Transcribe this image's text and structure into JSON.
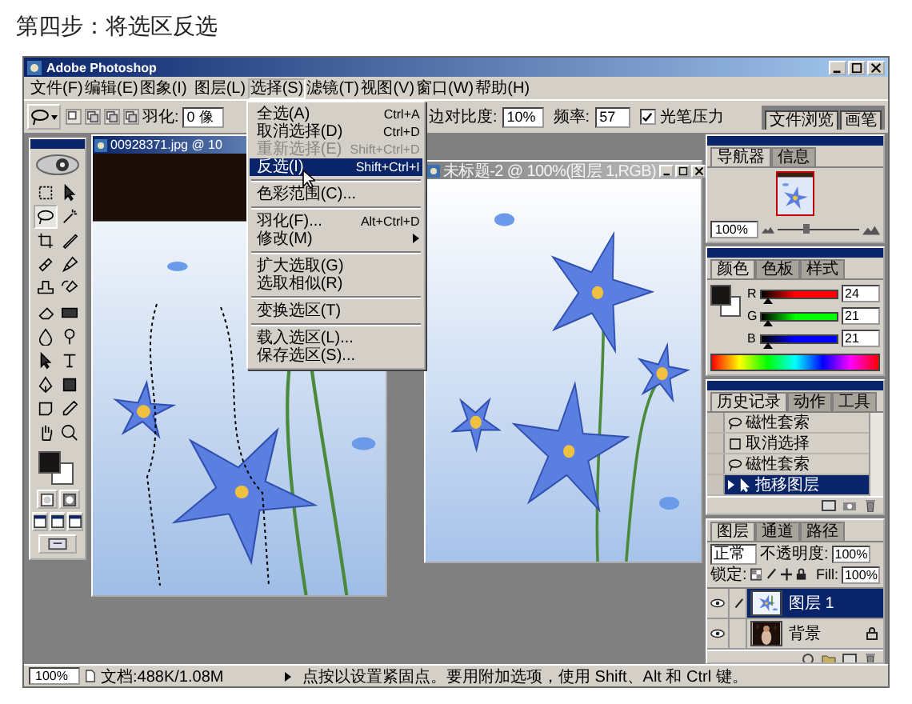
{
  "heading": "第四步：将选区反选",
  "window": {
    "title": "Adobe Photoshop"
  },
  "menu_bar": [
    {
      "label": "文件(F)",
      "selected": false
    },
    {
      "label": "编辑(E)",
      "selected": false
    },
    {
      "label": "图象(I)",
      "selected": false
    },
    {
      "label": "图层(L)",
      "selected": false
    },
    {
      "label": "选择(S)",
      "selected": true
    },
    {
      "label": "滤镜(T)",
      "selected": false
    },
    {
      "label": "视图(V)",
      "selected": false
    },
    {
      "label": "窗口(W)",
      "selected": false
    },
    {
      "label": "帮助(H)",
      "selected": false
    }
  ],
  "select_menu": [
    {
      "kind": "item",
      "label": "全选(A)",
      "shortcut": "Ctrl+A",
      "disabled": false,
      "selected": false
    },
    {
      "kind": "item",
      "label": "取消选择(D)",
      "shortcut": "Ctrl+D",
      "disabled": false,
      "selected": false
    },
    {
      "kind": "item",
      "label": "重新选择(E)",
      "shortcut": "Shift+Ctrl+D",
      "disabled": true,
      "selected": false
    },
    {
      "kind": "item",
      "label": "反选(I)",
      "shortcut": "Shift+Ctrl+I",
      "disabled": false,
      "selected": true
    },
    {
      "kind": "separator"
    },
    {
      "kind": "item",
      "label": "色彩范围(C)...",
      "disabled": false,
      "selected": false
    },
    {
      "kind": "separator"
    },
    {
      "kind": "item",
      "label": "羽化(F)...",
      "shortcut": "Alt+Ctrl+D",
      "disabled": false,
      "selected": false
    },
    {
      "kind": "submenu",
      "label": "修改(M)",
      "disabled": false,
      "selected": false
    },
    {
      "kind": "separator"
    },
    {
      "kind": "item",
      "label": "扩大选取(G)",
      "disabled": false,
      "selected": false
    },
    {
      "kind": "item",
      "label": "选取相似(R)",
      "disabled": false,
      "selected": false
    },
    {
      "kind": "separator"
    },
    {
      "kind": "item",
      "label": "变换选区(T)",
      "disabled": false,
      "selected": false
    },
    {
      "kind": "separator"
    },
    {
      "kind": "item",
      "label": "载入选区(L)...",
      "disabled": false,
      "selected": false
    },
    {
      "kind": "item",
      "label": "保存选区(S)...",
      "disabled": false,
      "selected": false
    }
  ],
  "options_bar": {
    "feather_label": "羽化:",
    "feather_value": "0 像",
    "contrast_label": "边对比度:",
    "contrast_value": "10%",
    "frequency_label": "频率:",
    "frequency_value": "57",
    "pen_pressure": {
      "label": "光笔压力",
      "checked": true
    }
  },
  "palette_well": [
    "文件浏览",
    "画笔"
  ],
  "toolbox": {
    "tools": [
      {
        "kind": "marquee",
        "selected": false
      },
      {
        "kind": "move",
        "selected": false
      },
      {
        "kind": "lasso",
        "selected": true
      },
      {
        "kind": "wand",
        "selected": false
      },
      {
        "kind": "crop",
        "selected": false
      },
      {
        "kind": "slice",
        "selected": false
      },
      {
        "kind": "heal",
        "selected": false
      },
      {
        "kind": "brush",
        "selected": false
      },
      {
        "kind": "stamp",
        "selected": false
      },
      {
        "kind": "history-brush",
        "selected": false
      },
      {
        "kind": "eraser",
        "selected": false
      },
      {
        "kind": "gradient",
        "selected": false
      },
      {
        "kind": "blur",
        "selected": false
      },
      {
        "kind": "dodge",
        "selected": false
      },
      {
        "kind": "path-select",
        "selected": false
      },
      {
        "kind": "type",
        "selected": false
      },
      {
        "kind": "pen",
        "selected": false
      },
      {
        "kind": "shape",
        "selected": false
      },
      {
        "kind": "notes",
        "selected": false
      },
      {
        "kind": "eyedropper",
        "selected": false
      },
      {
        "kind": "hand",
        "selected": false
      },
      {
        "kind": "zoom",
        "selected": false
      }
    ]
  },
  "documents": [
    {
      "title": "00928371.jpg @ 10",
      "active": true
    },
    {
      "title": "未标题-2 @ 100%(图层 1,RGB)",
      "active": false
    }
  ],
  "navigator": {
    "tabs": [
      {
        "label": "导航器",
        "selected": true
      },
      {
        "label": "信息",
        "selected": false
      }
    ],
    "zoom": "100%",
    "level": 0.35
  },
  "color": {
    "tabs": [
      {
        "label": "颜色",
        "selected": true
      },
      {
        "label": "色板",
        "selected": false
      },
      {
        "label": "样式",
        "selected": false
      }
    ],
    "channels": [
      {
        "name": "R",
        "value": "24",
        "level": 0.09,
        "color": "#ff0000"
      },
      {
        "name": "G",
        "value": "21",
        "level": 0.08,
        "color": "#00ff00"
      },
      {
        "name": "B",
        "value": "21",
        "level": 0.08,
        "color": "#0000ff"
      }
    ]
  },
  "history": {
    "tabs": [
      {
        "label": "历史记录",
        "selected": true
      },
      {
        "label": "动作",
        "selected": false
      },
      {
        "label": "工具",
        "selected": false
      }
    ],
    "items": [
      {
        "kind": "lasso",
        "label": "磁性套索",
        "selected": false
      },
      {
        "kind": "marquee",
        "label": "取消选择",
        "selected": false
      },
      {
        "kind": "lasso",
        "label": "磁性套索",
        "selected": false
      },
      {
        "kind": "move",
        "label": "拖移图层",
        "selected": true
      }
    ]
  },
  "layers": {
    "tabs": [
      {
        "label": "图层",
        "selected": true
      },
      {
        "label": "通道",
        "selected": false
      },
      {
        "label": "路径",
        "selected": false
      }
    ],
    "blend_mode": "正常",
    "opacity_label": "不透明度:",
    "opacity": "100%",
    "lock_label": "锁定:",
    "fill_label": "Fill:",
    "fill": "100%",
    "items": [
      {
        "name": "图层 1",
        "selected": true,
        "locked": false
      },
      {
        "name": "背景",
        "selected": false,
        "locked": true
      }
    ]
  },
  "status_bar": {
    "zoom": "100%",
    "doc_info": "文档:488K/1.08M",
    "hint": "点按以设置紧固点。要用附加选项，使用 Shift、Alt 和 Ctrl 键。"
  }
}
